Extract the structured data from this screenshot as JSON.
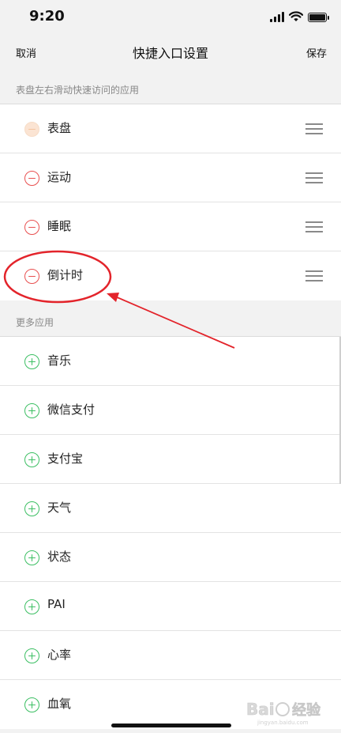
{
  "status_bar": {
    "time": "9:20"
  },
  "nav": {
    "cancel_label": "取消",
    "title": "快捷入口设置",
    "save_label": "保存"
  },
  "sections": [
    {
      "header": "表盘左右滑动快速访问的应用",
      "items": [
        {
          "label": "表盘",
          "action": "remove",
          "disabled": true
        },
        {
          "label": "运动",
          "action": "remove"
        },
        {
          "label": "睡眠",
          "action": "remove"
        },
        {
          "label": "倒计时",
          "action": "remove",
          "highlighted": true
        }
      ]
    },
    {
      "header": "更多应用",
      "items": [
        {
          "label": "音乐",
          "action": "add"
        },
        {
          "label": "微信支付",
          "action": "add"
        },
        {
          "label": "支付宝",
          "action": "add"
        },
        {
          "label": "天气",
          "action": "add"
        },
        {
          "label": "状态",
          "action": "add"
        },
        {
          "label": "PAI",
          "action": "add"
        },
        {
          "label": "心率",
          "action": "add"
        },
        {
          "label": "血氧",
          "action": "add"
        }
      ]
    }
  ],
  "colors": {
    "remove": "#e85050",
    "add": "#3cbf63",
    "annotation": "#e3242b",
    "background": "#f2f2f2"
  },
  "icons": {
    "remove": "minus-circle-icon",
    "add": "plus-circle-icon",
    "reorder": "drag-handle-icon"
  },
  "watermark": {
    "text": "Baidu经验"
  }
}
